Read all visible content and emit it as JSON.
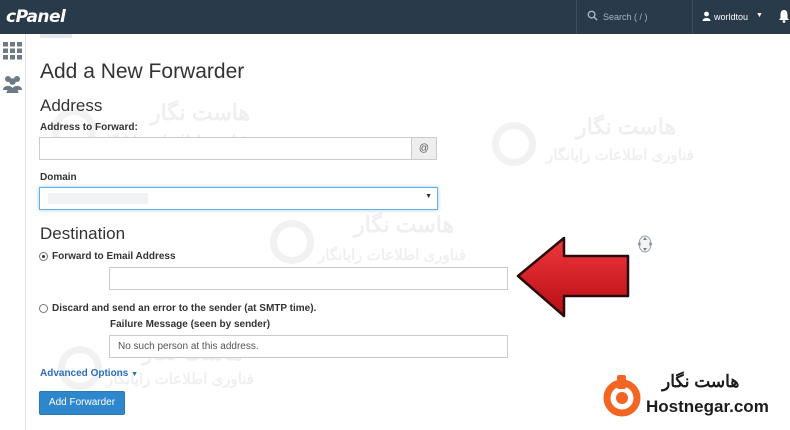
{
  "header": {
    "logo": "cPanel",
    "search_placeholder": "Search ( / )",
    "username": "worldtou"
  },
  "page": {
    "title": "Add a New Forwarder",
    "address_section": "Address",
    "address_label": "Address to Forward:",
    "address_value": "",
    "at_symbol": "@",
    "domain_label": "Domain",
    "destination_section": "Destination",
    "forward_option_label": "Forward to Email Address",
    "forward_email_value": "",
    "discard_option_label": "Discard and send an error to the sender (at SMTP time).",
    "failure_message_label": "Failure Message (seen by sender)",
    "failure_message_value": "No such person at this address.",
    "advanced_options": "Advanced Options",
    "submit_button": "Add Forwarder"
  },
  "watermark": {
    "title_fa": "هاست نگار",
    "subtitle_fa": "فناوری اطلاعات رایانگار"
  },
  "brand": {
    "name_fa": "هاست نگار",
    "name_en": "Hostnegar.com"
  },
  "colors": {
    "topbar": "#293a4a",
    "accent_blue": "#2e87cd",
    "link_blue": "#2a6ebb",
    "arrow_red": "#d8121c",
    "brand_orange": "#f26522"
  },
  "icons": {
    "sidebar": [
      "grid-icon",
      "users-icon"
    ],
    "header": [
      "search-icon",
      "user-icon",
      "bell-icon"
    ],
    "overlay": [
      "move-icon",
      "red-arrow"
    ]
  }
}
